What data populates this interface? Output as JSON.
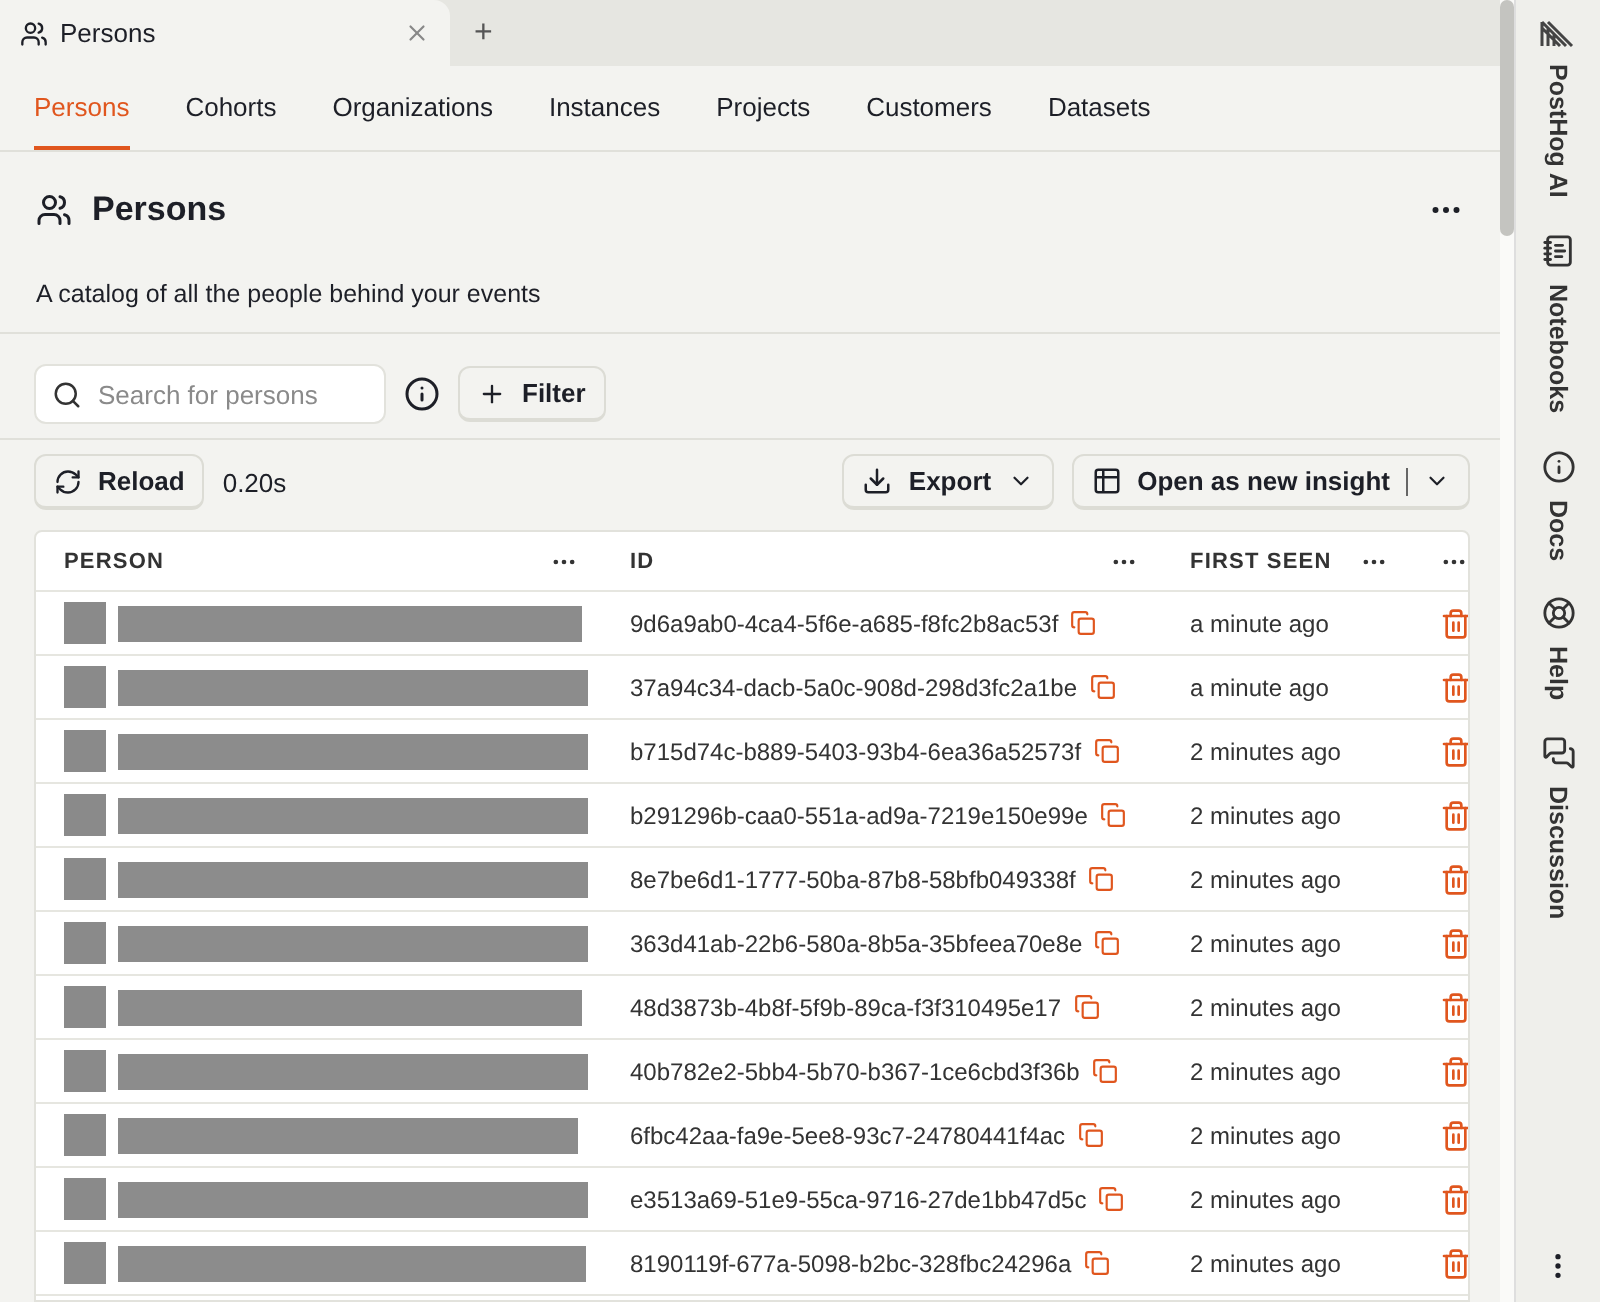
{
  "window_tabs": [
    {
      "label": "Persons",
      "selected": true
    },
    {
      "label": "+",
      "kind": "new"
    }
  ],
  "nav_tabs": [
    {
      "label": "Persons",
      "selected": true
    },
    {
      "label": "Cohorts",
      "selected": false
    },
    {
      "label": "Organizations",
      "selected": false
    },
    {
      "label": "Instances",
      "selected": false
    },
    {
      "label": "Projects",
      "selected": false
    },
    {
      "label": "Customers",
      "selected": false
    },
    {
      "label": "Datasets",
      "selected": false
    }
  ],
  "header": {
    "title": "Persons",
    "description": "A catalog of all the people behind your events"
  },
  "search": {
    "placeholder": "Search for persons"
  },
  "filter_button": "Filter",
  "reload_button": "Reload",
  "query_time": "0.20s",
  "export_button": "Export",
  "insight_button": "Open as new insight",
  "table": {
    "columns": [
      "PERSON",
      "ID",
      "FIRST SEEN"
    ],
    "rows": [
      {
        "id": "9d6a9ab0-4ca4-5f6e-a685-f8fc2b8ac53f",
        "first_seen": "a minute ago"
      },
      {
        "id": "37a94c34-dacb-5a0c-908d-298d3fc2a1be",
        "first_seen": "a minute ago"
      },
      {
        "id": "b715d74c-b889-5403-93b4-6ea36a52573f",
        "first_seen": "2 minutes ago"
      },
      {
        "id": "b291296b-caa0-551a-ad9a-7219e150e99e",
        "first_seen": "2 minutes ago"
      },
      {
        "id": "8e7be6d1-1777-50ba-87b8-58bfb049338f",
        "first_seen": "2 minutes ago"
      },
      {
        "id": "363d41ab-22b6-580a-8b5a-35bfeea70e8e",
        "first_seen": "2 minutes ago"
      },
      {
        "id": "48d3873b-4b8f-5f9b-89ca-f3f310495e17",
        "first_seen": "2 minutes ago"
      },
      {
        "id": "40b782e2-5bb4-5b70-b367-1ce6cbd3f36b",
        "first_seen": "2 minutes ago"
      },
      {
        "id": "6fbc42aa-fa9e-5ee8-93c7-24780441f4ac",
        "first_seen": "2 minutes ago"
      },
      {
        "id": "e3513a69-51e9-55ca-9716-27de1bb47d5c",
        "first_seen": "2 minutes ago"
      },
      {
        "id": "8190119f-677a-5098-b2bc-328fbc24296a",
        "first_seen": "2 minutes ago"
      }
    ]
  },
  "side_panel": [
    {
      "label": "PostHog AI",
      "kind": "ai"
    },
    {
      "label": "Notebooks",
      "kind": "notebook"
    },
    {
      "label": "Docs",
      "kind": "info"
    },
    {
      "label": "Help",
      "kind": "help"
    },
    {
      "label": "Discussion",
      "kind": "chat"
    }
  ]
}
